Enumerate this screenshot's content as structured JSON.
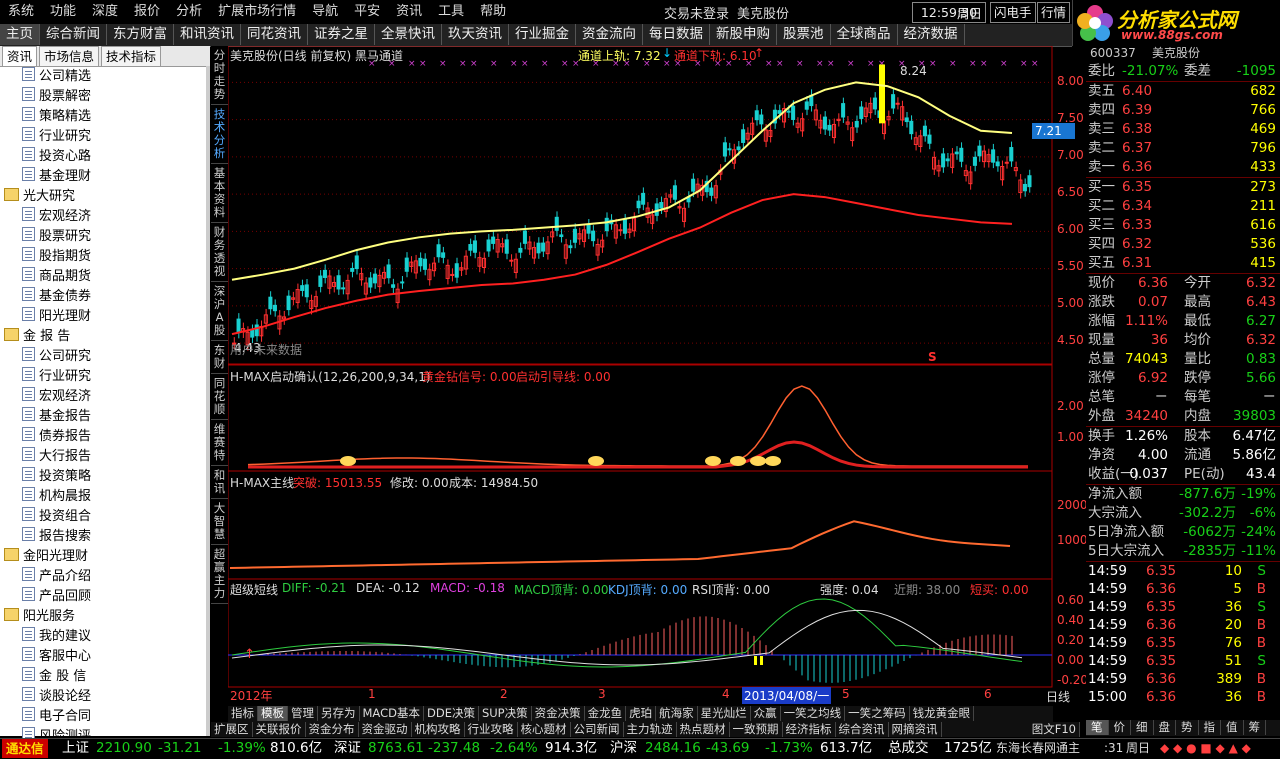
{
  "menubar": {
    "items": [
      "系统",
      "功能",
      "深度",
      "报价",
      "分析",
      "扩展市场行情",
      "导航",
      "平安",
      "资讯",
      "工具",
      "帮助"
    ],
    "login_status": "交易未登录",
    "stock_name": "美克股份",
    "time": "12:59:30",
    "weekday": "周日",
    "flash": "闪电手",
    "quote": "行情"
  },
  "brand": {
    "name": "分析家公式网",
    "url": "www.88gs.com"
  },
  "nav": {
    "tabs": [
      "主页",
      "综合新闻",
      "东方财富",
      "和讯资讯",
      "同花资讯",
      "证券之星",
      "全景快讯",
      "玖天资讯",
      "行业掘金",
      "资金流向",
      "每日数据",
      "新股申购",
      "股票池",
      "全球商品",
      "经济数据"
    ]
  },
  "leftpanel": {
    "tabs": [
      "资讯",
      "市场信息",
      "技术指标"
    ],
    "tree": [
      {
        "type": "leaf",
        "label": "公司精选"
      },
      {
        "type": "leaf",
        "label": "股票解密"
      },
      {
        "type": "leaf",
        "label": "策略精选"
      },
      {
        "type": "leaf",
        "label": "行业研究"
      },
      {
        "type": "leaf",
        "label": "投资心路"
      },
      {
        "type": "leaf",
        "label": "基金理财"
      },
      {
        "type": "folder",
        "label": "光大研究"
      },
      {
        "type": "leaf",
        "label": "宏观经济"
      },
      {
        "type": "leaf",
        "label": "股票研究"
      },
      {
        "type": "leaf",
        "label": "股指期货"
      },
      {
        "type": "leaf",
        "label": "商品期货"
      },
      {
        "type": "leaf",
        "label": "基金债券"
      },
      {
        "type": "leaf",
        "label": "阳光理财"
      },
      {
        "type": "folder",
        "label": "金 报 告"
      },
      {
        "type": "leaf",
        "label": "公司研究"
      },
      {
        "type": "leaf",
        "label": "行业研究"
      },
      {
        "type": "leaf",
        "label": "宏观经济"
      },
      {
        "type": "leaf",
        "label": "基金报告"
      },
      {
        "type": "leaf",
        "label": "债券报告"
      },
      {
        "type": "leaf",
        "label": "大行报告"
      },
      {
        "type": "leaf",
        "label": "投资策略"
      },
      {
        "type": "leaf",
        "label": "机构晨报"
      },
      {
        "type": "leaf",
        "label": "投资组合"
      },
      {
        "type": "leaf",
        "label": "报告搜索"
      },
      {
        "type": "folder",
        "label": "金阳光理财"
      },
      {
        "type": "leaf",
        "label": "产品介绍"
      },
      {
        "type": "leaf",
        "label": "产品回顾"
      },
      {
        "type": "folder",
        "label": "阳光服务"
      },
      {
        "type": "leaf",
        "label": "我的建议"
      },
      {
        "type": "leaf",
        "label": "客服中心"
      },
      {
        "type": "leaf",
        "label": "金 股 信"
      },
      {
        "type": "leaf",
        "label": "谈股论经"
      },
      {
        "type": "leaf",
        "label": "电子合同"
      },
      {
        "type": "leaf",
        "label": "风险测评"
      }
    ]
  },
  "sidetabs": [
    "分时走势",
    "技术分析",
    "基本资料",
    "财务透视",
    "深沪A股",
    "东财",
    "同花顺",
    "维赛特",
    "和讯",
    "大智慧",
    "超赢主力"
  ],
  "chart": {
    "main_title": "美克股份(日线 前复权) 黑马通道",
    "upper_label": "通道上轨: 7.32",
    "lower_label": "通道下轨: 6.10",
    "high_marker": "8.24",
    "low_marker": "4.43",
    "watermark": "用户未来数据",
    "s_marker": "S",
    "price_axis": [
      "8.00",
      "7.50",
      "7.00",
      "6.50",
      "6.00",
      "5.50",
      "5.00",
      "4.50"
    ],
    "current_price_tag": "7.21",
    "hmax1_title": "H-MAX启动确认(12,26,200,9,34,1)",
    "hmax1_gold": "黄金钻信号: 0.00",
    "hmax1_start": "启动引导线: 0.00",
    "hmax1_axis": [
      "2.00",
      "1.00"
    ],
    "hmax2_title": "H-MAX主线",
    "hmax2_break": "突破: 15013.55",
    "hmax2_fix": "修改: 0.00",
    "hmax2_cost": "成本: 14984.50",
    "hmax2_axis": [
      "20000",
      "10000"
    ],
    "macd_title": "超级短线",
    "macd_diff": "DIFF: -0.21",
    "macd_dea": "DEA: -0.12",
    "macd_macd": "MACD: -0.18",
    "macd_top": "MACD顶背: 0.00",
    "kdj_top": "KDJ顶背: 0.00",
    "rsi_top": "RSI顶背: 0.00",
    "strength": "强度: 0.04",
    "near": "近期: 38.00",
    "short_buy": "短买: 0.00",
    "macd_axis": [
      "0.60",
      "0.40",
      "0.20",
      "0.00",
      "-0.20"
    ],
    "timeline": [
      "2012年",
      "1",
      "2",
      "3",
      "4",
      "2013/04/08/一",
      "5",
      "6"
    ],
    "period": "日线"
  },
  "chart_data": {
    "type": "line",
    "title": "美克股份(日线 前复权) 黑马通道",
    "xlabel": "",
    "ylabel": "",
    "ylim": [
      4.3,
      8.3
    ],
    "series": [
      {
        "name": "通道上轨",
        "color": "#ffff80",
        "values": [
          5.35,
          5.42,
          5.5,
          5.62,
          5.75,
          5.85,
          5.92,
          5.97,
          6.0,
          6.02,
          6.05,
          6.08,
          6.12,
          6.2,
          6.32,
          6.55,
          6.95,
          7.35,
          7.72,
          7.9,
          8.0,
          7.95,
          7.8,
          7.55,
          7.35,
          7.32
        ]
      },
      {
        "name": "通道下轨",
        "color": "#ff2020",
        "values": [
          4.62,
          4.72,
          4.85,
          4.97,
          5.07,
          5.15,
          5.2,
          5.24,
          5.28,
          5.3,
          5.35,
          5.42,
          5.55,
          5.72,
          5.9,
          6.05,
          6.25,
          6.42,
          6.5,
          6.46,
          6.38,
          6.3,
          6.22,
          6.17,
          6.12,
          6.1
        ]
      }
    ],
    "close": [
      4.5,
      4.8,
      5.1,
      5.3,
      5.4,
      5.3,
      5.6,
      5.5,
      5.8,
      5.7,
      5.9,
      5.9,
      6.0,
      6.3,
      6.4,
      6.6,
      7.3,
      7.5,
      7.6,
      7.4,
      7.6,
      7.6,
      7.0,
      6.9,
      7.0,
      6.6
    ]
  },
  "quote": {
    "code": "600337",
    "name": "美克股份",
    "wb_label": "委比",
    "wb": "-21.07%",
    "wc_label": "委差",
    "wc": "-1095",
    "asks": [
      {
        "label": "卖五",
        "price": "6.40",
        "vol": "682"
      },
      {
        "label": "卖四",
        "price": "6.39",
        "vol": "766"
      },
      {
        "label": "卖三",
        "price": "6.38",
        "vol": "469"
      },
      {
        "label": "卖二",
        "price": "6.37",
        "vol": "796"
      },
      {
        "label": "卖一",
        "price": "6.36",
        "vol": "433"
      }
    ],
    "bids": [
      {
        "label": "买一",
        "price": "6.35",
        "vol": "273"
      },
      {
        "label": "买二",
        "price": "6.34",
        "vol": "211"
      },
      {
        "label": "买三",
        "price": "6.33",
        "vol": "616"
      },
      {
        "label": "买四",
        "price": "6.32",
        "vol": "536"
      },
      {
        "label": "买五",
        "price": "6.31",
        "vol": "415"
      }
    ],
    "stats": [
      {
        "l1": "现价",
        "v1": "6.36",
        "c1": "red",
        "l2": "今开",
        "v2": "6.32",
        "c2": "red"
      },
      {
        "l1": "涨跌",
        "v1": "0.07",
        "c1": "red",
        "l2": "最高",
        "v2": "6.43",
        "c2": "red"
      },
      {
        "l1": "涨幅",
        "v1": "1.11%",
        "c1": "red",
        "l2": "最低",
        "v2": "6.27",
        "c2": "green"
      },
      {
        "l1": "现量",
        "v1": "36",
        "c1": "red",
        "l2": "均价",
        "v2": "6.32",
        "c2": "red"
      },
      {
        "l1": "总量",
        "v1": "74043",
        "c1": "yellow",
        "l2": "量比",
        "v2": "0.83",
        "c2": "green"
      },
      {
        "l1": "涨停",
        "v1": "6.92",
        "c1": "red",
        "l2": "跌停",
        "v2": "5.66",
        "c2": "green"
      },
      {
        "l1": "总笔",
        "v1": "－",
        "c1": "white",
        "l2": "每笔",
        "v2": "－",
        "c2": "white"
      },
      {
        "l1": "外盘",
        "v1": "34240",
        "c1": "red",
        "l2": "内盘",
        "v2": "39803",
        "c2": "green"
      }
    ],
    "stats2": [
      {
        "l1": "换手",
        "v1": "1.26%",
        "l2": "股本",
        "v2": "6.47亿"
      },
      {
        "l1": "净资",
        "v1": "4.00",
        "l2": "流通",
        "v2": "5.86亿"
      },
      {
        "l1": "收益(一)",
        "v1": "0.037",
        "l2": "PE(动)",
        "v2": "43.4"
      }
    ],
    "flows": [
      {
        "label": "净流入额",
        "value": "-877.6万",
        "pct": "-19%"
      },
      {
        "label": "大宗流入",
        "value": "-302.2万",
        "pct": "-6%"
      },
      {
        "label": "5日净流入额",
        "value": "-6062万",
        "pct": "-24%"
      },
      {
        "label": "5日大宗流入",
        "value": "-2835万",
        "pct": "-11%"
      }
    ],
    "ticks": [
      {
        "time": "14:59",
        "price": "6.35",
        "vol": "10",
        "side": "S"
      },
      {
        "time": "14:59",
        "price": "6.36",
        "vol": "5",
        "side": "B"
      },
      {
        "time": "14:59",
        "price": "6.35",
        "vol": "36",
        "side": "S"
      },
      {
        "time": "14:59",
        "price": "6.36",
        "vol": "20",
        "side": "B"
      },
      {
        "time": "14:59",
        "price": "6.35",
        "vol": "76",
        "side": "B"
      },
      {
        "time": "14:59",
        "price": "6.35",
        "vol": "51",
        "side": "S"
      },
      {
        "time": "14:59",
        "price": "6.36",
        "vol": "389",
        "side": "B"
      },
      {
        "time": "15:00",
        "price": "6.36",
        "vol": "36",
        "side": "B"
      }
    ],
    "bottom_tabs": [
      "笔",
      "价",
      "细",
      "盘",
      "势",
      "指",
      "值",
      "筹"
    ]
  },
  "bottom": {
    "tabs": [
      "指标",
      "模板",
      "管理",
      "另存为",
      "MACD基本",
      "DDE决策",
      "SUP决策",
      "资金决策",
      "金龙鱼",
      "虎珀",
      "航海家",
      "星光灿烂",
      "众赢",
      "一笑之均线",
      "一笑之筹码",
      "钱龙黄金眼"
    ],
    "active_tab": "模板",
    "subtabs": [
      "扩展区",
      "关联报价",
      "资金分布",
      "资金驱动",
      "机构攻略",
      "行业攻略",
      "核心题材",
      "公司新闻",
      "主力轨迹",
      "热点题材",
      "一致预期",
      "经济指标",
      "综合资讯",
      "网摘资讯"
    ],
    "figure_label": "图文F10"
  },
  "status": {
    "brand": "通达信",
    "sh_label": "上证",
    "sh": "2210.90",
    "sh_chg": "-31.21",
    "sh_pct": "-1.39%",
    "sh_amt": "810.6亿",
    "sz_label": "深证",
    "sz": "8763.61",
    "sz_chg": "-237.48",
    "sz_pct": "-2.64%",
    "sz_amt": "914.3亿",
    "hs_label": "沪深",
    "hs": "2484.16",
    "hs_chg": "-43.69",
    "hs_pct": "-1.73%",
    "hs_amt": "613.7亿",
    "total_label": "总成交",
    "total": "1725亿",
    "broker": "东海长春网通主",
    "time": ":31",
    "weekday": "周日"
  }
}
